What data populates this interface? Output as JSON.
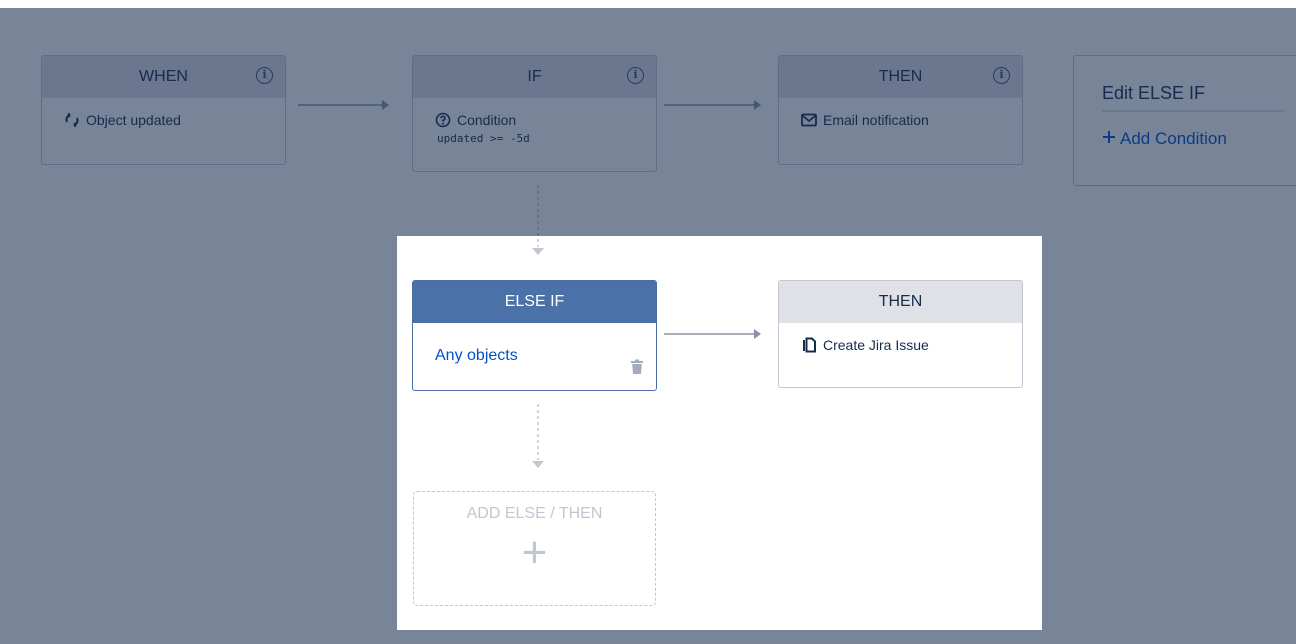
{
  "nodes": {
    "when": {
      "header": "WHEN",
      "label": "Object updated"
    },
    "if": {
      "header": "IF",
      "label": "Condition",
      "sub": "updated >= -5d"
    },
    "then1": {
      "header": "THEN",
      "label": "Email notification"
    },
    "else_if": {
      "header": "ELSE IF",
      "label": "Any objects"
    },
    "then2": {
      "header": "THEN",
      "label": "Create Jira Issue"
    },
    "add": {
      "label": "ADD ELSE / THEN",
      "plus": "+"
    }
  },
  "edit_panel": {
    "title": "Edit ELSE IF",
    "add_condition": "Add Condition"
  },
  "info_glyph": "i",
  "colors": {
    "overlay": "#172b4d",
    "else_if_header": "#4a71a8",
    "link": "#0052cc"
  }
}
